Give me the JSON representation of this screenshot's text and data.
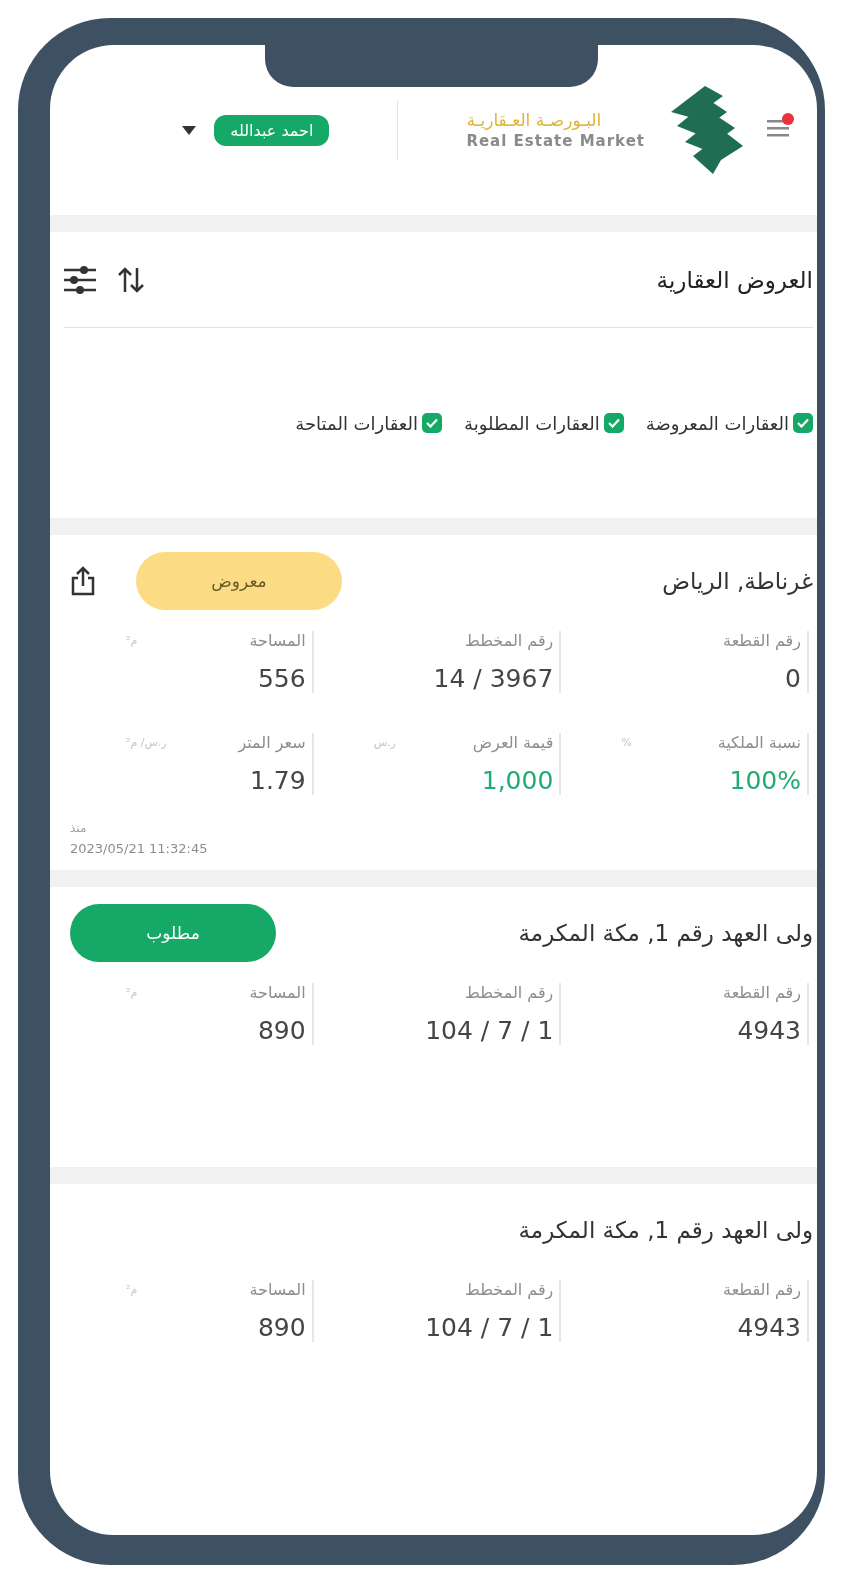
{
  "header": {
    "user_name": "احمد عبدالله",
    "brand_ar": "البـورصـة العـقاريـة",
    "brand_en": "Real Estate Market",
    "menu_notification": true
  },
  "section": {
    "title": "العروض العقارية"
  },
  "filters": [
    {
      "label": "العقارات المعروضة",
      "checked": true
    },
    {
      "label": "العقارات المطلوبة",
      "checked": true
    },
    {
      "label": "العقارات المتاحة",
      "checked": true
    }
  ],
  "listings": [
    {
      "title": "غرناطة, الرياض",
      "status": {
        "kind": "offered",
        "label": "معروض"
      },
      "shareable": true,
      "fields": [
        {
          "label": "رقم القطعة",
          "value": "0",
          "highlighted": false
        },
        {
          "label": "رقم المخطط",
          "value": "14 / 3967",
          "highlighted": false
        },
        {
          "label": "المساحة",
          "unit": "م²",
          "value": "556",
          "highlighted": false
        },
        {
          "label": "نسبة الملكية",
          "unit": "%",
          "value": "100%",
          "highlighted": true
        },
        {
          "label": "قيمة العرض",
          "unit": "ر.س",
          "value": "1,000",
          "highlighted": true
        },
        {
          "label": "سعر المتر",
          "unit": "ر.س/ م²",
          "value": "1.79",
          "highlighted": false
        }
      ],
      "since_label": "منذ",
      "date": "2023/05/21 11:32:45"
    },
    {
      "title": "ولى العهد رقم 1, مكة المكرمة",
      "status": {
        "kind": "requested",
        "label": "مطلوب"
      },
      "shareable": false,
      "fields": [
        {
          "label": "رقم القطعة",
          "value": "4943",
          "highlighted": false
        },
        {
          "label": "رقم المخطط",
          "value": "104 / 7 / 1",
          "highlighted": false
        },
        {
          "label": "المساحة",
          "unit": "م²",
          "value": "890",
          "highlighted": false
        }
      ]
    },
    {
      "title": "ولى العهد رقم 1, مكة المكرمة",
      "shareable": false,
      "fields": [
        {
          "label": "رقم القطعة",
          "value": "4943",
          "highlighted": false
        },
        {
          "label": "رقم المخطط",
          "value": "104 / 7 / 1",
          "highlighted": false
        },
        {
          "label": "المساحة",
          "unit": "م²",
          "value": "890",
          "highlighted": false
        }
      ]
    }
  ]
}
